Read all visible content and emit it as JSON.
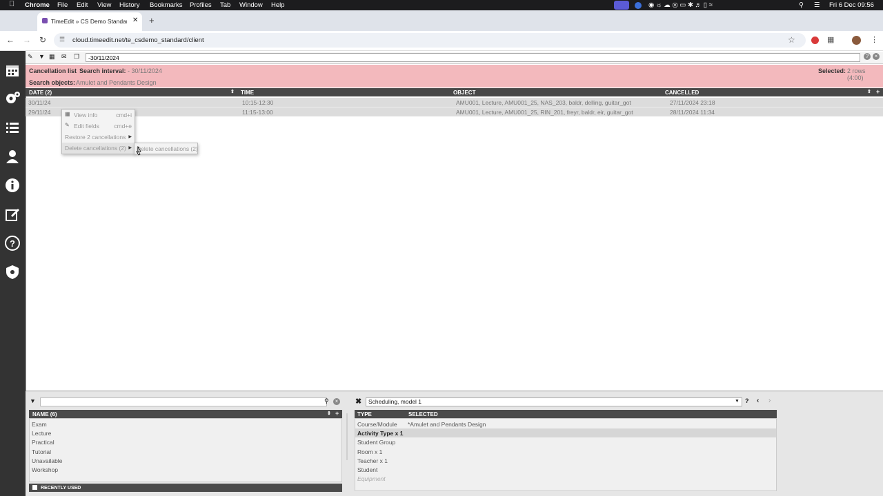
{
  "menubar": {
    "app": "Chrome",
    "items": [
      "File",
      "Edit",
      "View",
      "History",
      "Bookmarks",
      "Profiles",
      "Tab",
      "Window",
      "Help"
    ],
    "clock": "Fri 6 Dec  09:56"
  },
  "browser": {
    "tab_title": "TimeEdit » CS Demo Standar",
    "url": "cloud.timeedit.net/te_csdemo_standard/client"
  },
  "toolbar": {
    "interval_value": "-30/11/2024"
  },
  "header": {
    "list_title": "Cancellation list",
    "search_interval_label": "Search interval:",
    "search_interval_value": "- 30/11/2024",
    "selected_label": "Selected:",
    "selected_value": "2 rows (4:00)",
    "search_objects_label": "Search objects:",
    "search_objects_value": "Amulet and Pendants Design"
  },
  "table": {
    "columns": {
      "date": "DATE (2)",
      "time": "TIME",
      "object": "OBJECT",
      "cancelled": "CANCELLED"
    },
    "rows": [
      {
        "date": "30/11/24",
        "time": "10:15-12:30",
        "object": "AMU001, Lecture, AMU001_25, NAS_203, baldr, delling, guitar_got",
        "cancelled": "27/11/2024 23:18"
      },
      {
        "date": "29/11/24",
        "time": "11:15-13:00",
        "object": "AMU001, Lecture, AMU001_25, RIN_201, freyr, baldr, eir, guitar_got",
        "cancelled": "28/11/2024 11:34"
      }
    ]
  },
  "context_menu": {
    "view_info": "View info",
    "view_info_shortcut": "cmd+i",
    "edit_fields": "Edit fields",
    "edit_fields_shortcut": "cmd+e",
    "restore": "Restore 2 cancellations",
    "delete": "Delete cancellations (2)",
    "submenu_delete": "Delete cancellations (2)"
  },
  "left_panel": {
    "header": "NAME (6)",
    "items": [
      "Exam",
      "Lecture",
      "Practical",
      "Tutorial",
      "Unavailable",
      "Workshop"
    ],
    "footer": "RECENTLY USED"
  },
  "right_panel": {
    "model_select": "Scheduling, model 1",
    "col_type": "TYPE",
    "col_selected": "SELECTED",
    "rows": [
      {
        "type": "Course/Module",
        "selected": "*Amulet and Pendants Design"
      },
      {
        "type": "Activity Type x 1",
        "selected": ""
      },
      {
        "type": "Student Group",
        "selected": ""
      },
      {
        "type": "Room x 1",
        "selected": ""
      },
      {
        "type": "Teacher x 1",
        "selected": ""
      },
      {
        "type": "Student",
        "selected": ""
      },
      {
        "type": "Equipment",
        "selected": ""
      }
    ]
  }
}
